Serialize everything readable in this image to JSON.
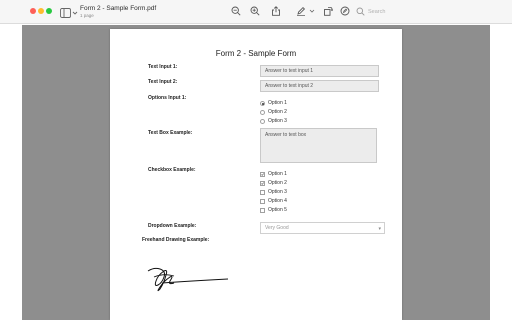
{
  "window": {
    "title": "Form 2 - Sample Form.pdf",
    "subtitle": "1 page"
  },
  "toolbar": {
    "search_placeholder": "Search"
  },
  "form": {
    "title": "Form 2 - Sample Form",
    "text_input_1": {
      "label": "Text Input 1:",
      "value": "Answer to text input 1"
    },
    "text_input_2": {
      "label": "Text Input 2:",
      "value": "Answer to text input 2"
    },
    "options_input": {
      "label": "Options Input 1:",
      "options": [
        {
          "label": "Option 1",
          "selected": true
        },
        {
          "label": "Option 2",
          "selected": false
        },
        {
          "label": "Option 3",
          "selected": false
        }
      ]
    },
    "text_box": {
      "label": "Text Box Example:",
      "value": "Answer to text box"
    },
    "checkbox": {
      "label": "Checkbox Example:",
      "options": [
        {
          "label": "Option 1",
          "checked": true
        },
        {
          "label": "Option 2",
          "checked": false
        },
        {
          "label": "Option 3",
          "checked": true
        },
        {
          "label": "Option 4",
          "checked": false
        },
        {
          "label": "Option 5",
          "checked": false
        }
      ]
    },
    "dropdown": {
      "label": "Dropdown Example:",
      "value": "Very Good"
    },
    "freehand": {
      "label": "Freehand Drawing Example:"
    }
  },
  "colors": {
    "traffic_red": "#fe5f57",
    "traffic_yellow": "#febc2e",
    "traffic_green": "#28c840",
    "canvas_bg": "#8e8e8e",
    "field_bg": "#ececec"
  },
  "icons": [
    "sidebar-icon",
    "zoom-out-icon",
    "zoom-in-icon",
    "share-icon",
    "markup-pen-icon",
    "chevron-down-icon",
    "rotate-icon",
    "annotate-icon",
    "search-icon"
  ]
}
